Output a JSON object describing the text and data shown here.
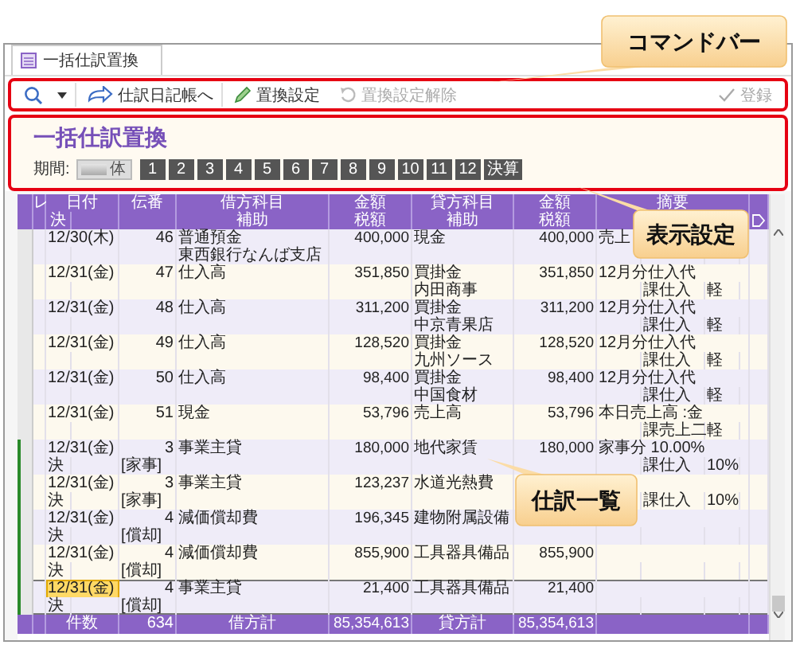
{
  "tab": {
    "label": "一括仕訳置換",
    "selected": true
  },
  "command_bar": {
    "items": [
      {
        "kind": "search",
        "disabled": false
      },
      {
        "kind": "journal",
        "label": "仕訳日記帳へ",
        "disabled": false
      },
      {
        "kind": "edit",
        "label": "置換設定",
        "disabled": false
      },
      {
        "kind": "undo",
        "label": "置換設定解除",
        "disabled": true
      },
      {
        "kind": "register",
        "label": "登録",
        "disabled": true
      }
    ]
  },
  "panel": {
    "title": "一括仕訳置換",
    "period_label": "期間:",
    "period_mode": "体",
    "periods": [
      "1",
      "2",
      "3",
      "4",
      "5",
      "6",
      "7",
      "8",
      "9",
      "10",
      "11",
      "12",
      "決算"
    ]
  },
  "table": {
    "columns": [
      "レ",
      "日付",
      "伝番",
      "借方科目",
      "金額",
      "貸方科目",
      "金額",
      "摘要"
    ],
    "subcolumns": [
      "決",
      "補助",
      "税額",
      "補助",
      "税額"
    ],
    "entries": [
      {
        "date": "12/30(木)",
        "voucher": "46",
        "debit_account": "普通預金",
        "debit_amount": "400,000",
        "credit_account": "現金",
        "credit_amount": "400,000",
        "memo": "売上",
        "debit_sub": "東西銀行なんば支店",
        "marked": false,
        "selected": false
      },
      {
        "date": "12/31(金)",
        "voucher": "47",
        "debit_account": "仕入高",
        "debit_amount": "351,850",
        "credit_account": "買掛金",
        "credit_amount": "351,850",
        "memo": "12月分仕入代",
        "credit_sub": "内田商事",
        "tax_class": "課仕入",
        "tax_rate": "軽",
        "marked": false,
        "selected": false
      },
      {
        "date": "12/31(金)",
        "voucher": "48",
        "debit_account": "仕入高",
        "debit_amount": "311,200",
        "credit_account": "買掛金",
        "credit_amount": "311,200",
        "memo": "12月分仕入代",
        "credit_sub": "中京青果店",
        "tax_class": "課仕入",
        "tax_rate": "軽",
        "marked": false,
        "selected": false
      },
      {
        "date": "12/31(金)",
        "voucher": "49",
        "debit_account": "仕入高",
        "debit_amount": "128,520",
        "credit_account": "買掛金",
        "credit_amount": "128,520",
        "memo": "12月分仕入代",
        "credit_sub": "九州ソース",
        "tax_class": "課仕入",
        "tax_rate": "軽",
        "marked": false,
        "selected": false
      },
      {
        "date": "12/31(金)",
        "voucher": "50",
        "debit_account": "仕入高",
        "debit_amount": "98,400",
        "credit_account": "買掛金",
        "credit_amount": "98,400",
        "memo": "12月分仕入代",
        "credit_sub": "中国食材",
        "tax_class": "課仕入",
        "tax_rate": "軽",
        "marked": false,
        "selected": false
      },
      {
        "date": "12/31(金)",
        "voucher": "51",
        "debit_account": "現金",
        "debit_amount": "53,796",
        "credit_account": "売上高",
        "credit_amount": "53,796",
        "memo": "本日売上高 :金",
        "tax_class": "課売上二",
        "tax_rate": "軽",
        "marked": false,
        "selected": false
      },
      {
        "date": "12/31(金)",
        "voucher": "3",
        "debit_account": "事業主貸",
        "debit_amount": "180,000",
        "credit_account": "地代家賃",
        "credit_amount": "180,000",
        "memo": "家事分 10.00%",
        "flag": "決",
        "voucher_sub": "[家事]",
        "tax_class": "課仕入",
        "tax_rate": "10%",
        "marked": true,
        "selected": false
      },
      {
        "date": "12/31(金)",
        "voucher": "3",
        "debit_account": "事業主貸",
        "debit_amount": "123,237",
        "credit_account": "水道光熱費",
        "flag": "決",
        "voucher_sub": "[家事]",
        "tax_class": "課仕入",
        "tax_rate": "10%",
        "marked": true,
        "selected": false
      },
      {
        "date": "12/31(金)",
        "voucher": "4",
        "debit_account": "減価償却費",
        "debit_amount": "196,345",
        "credit_account": "建物附属設備",
        "flag": "決",
        "voucher_sub": "[償却]",
        "marked": true,
        "selected": false
      },
      {
        "date": "12/31(金)",
        "voucher": "4",
        "debit_account": "減価償却費",
        "debit_amount": "855,900",
        "credit_account": "工具器具備品",
        "credit_amount": "855,900",
        "flag": "決",
        "voucher_sub": "[償却]",
        "marked": true,
        "selected": false
      },
      {
        "date": "12/31(金)",
        "voucher": "4",
        "debit_account": "事業主貸",
        "debit_amount": "21,400",
        "credit_account": "工具器具備品",
        "credit_amount": "21,400",
        "flag": "決",
        "voucher_sub": "[償却]",
        "marked": true,
        "selected": true
      }
    ],
    "footer": {
      "count_label": "件数",
      "count": "634",
      "debit_total_label": "借方計",
      "debit_total": "85,354,613",
      "credit_total_label": "貸方計",
      "credit_total": "85,354,613"
    }
  },
  "callouts": [
    {
      "label": "コマンドバー"
    },
    {
      "label": "表示設定"
    },
    {
      "label": "仕訳一覧"
    }
  ]
}
